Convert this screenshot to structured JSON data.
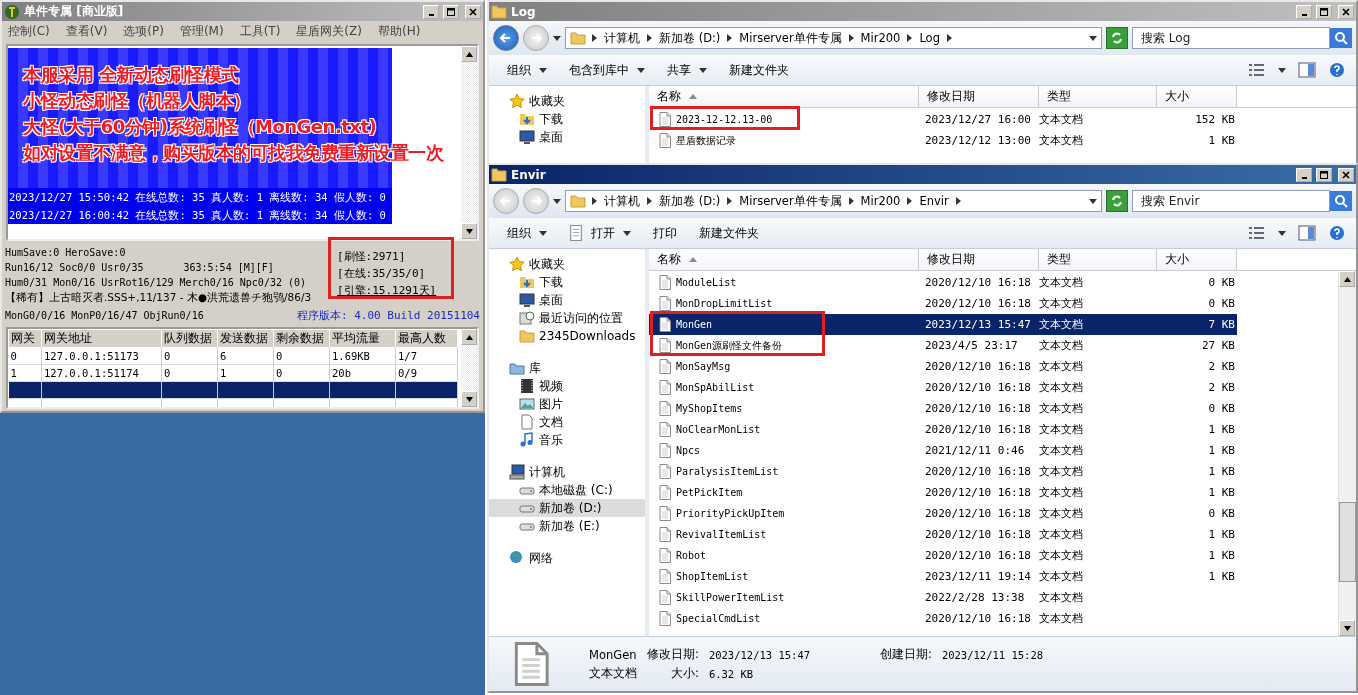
{
  "server_window": {
    "title": "单件专属 [商业版]",
    "active": false,
    "menu": [
      "控制(C)",
      "查看(V)",
      "选项(P)",
      "管理(M)",
      "工具(T)",
      "星盾网关(Z)",
      "帮助(H)"
    ],
    "overlay_lines": [
      "本服采用 全新动态刷怪模式",
      "小怪动态刷怪（机器人脚本）",
      "大怪(大于60分钟)系统刷怪（MonGen.txt)",
      "如对设置不满意，购买版本的可找我免费重新设置一次"
    ],
    "log_lines": [
      "2023/12/27 15:50:42 在线总数: 35 真人数: 1 离线数: 34 假人数: 0",
      "2023/12/27 16:00:42 在线总数: 35 真人数: 1 离线数: 34 假人数: 0"
    ],
    "status_lines": [
      "HumSave:0 HeroSave:0",
      "Run16/12 Soc0/0 Usr0/35",
      "Hum0/31 Mon0/16 UsrRot16/129 Merch0/16 Npc0/32 (0)",
      "【稀有】上古暗灭者.SSS+,11/137 - 木●洪荒遗兽チ狍鸮/86/3",
      "MonG0/0/16 MonP0/16/47 ObjRun0/16"
    ],
    "clock": "363:5:54 [M][F]",
    "counters": [
      "[刷怪:2971]",
      "[在线:35/35/0]",
      "[引擎:15.1291天]"
    ],
    "version": "程序版本: 4.00 Build 20151104",
    "gateway_table": {
      "columns": [
        "网关",
        "网关地址",
        "队列数据",
        "发送数据",
        "剩余数据",
        "平均流量",
        "最高人数"
      ],
      "rows": [
        {
          "cells": [
            "0",
            "127.0.0.1:51173",
            "0",
            "6",
            "0",
            "1.69KB",
            "1/7"
          ],
          "selected": false
        },
        {
          "cells": [
            "1",
            "127.0.0.1:51174",
            "0",
            "1",
            "0",
            "20b",
            "0/9"
          ],
          "selected": false
        },
        {
          "selected": true
        }
      ]
    }
  },
  "log_window": {
    "title": "Log",
    "active": false,
    "back_enabled": true,
    "breadcrumb": [
      "计算机",
      "新加卷 (D:)",
      "Mirserver单件专属",
      "Mir200",
      "Log"
    ],
    "search": {
      "placeholder": "搜索 Log"
    },
    "toolbar": [
      {
        "label": "组织",
        "dropdown": true
      },
      {
        "label": "包含到库中",
        "dropdown": true
      },
      {
        "label": "共享",
        "dropdown": true
      },
      {
        "label": "新建文件夹",
        "dropdown": false
      }
    ],
    "nav": [
      {
        "label": "收藏夹",
        "kind": "favorites",
        "selected": false,
        "children": [
          {
            "label": "下载",
            "kind": "downloads",
            "selected": false
          },
          {
            "label": "桌面",
            "kind": "desktop",
            "selected": false
          }
        ]
      }
    ],
    "columns": [
      "名称",
      "修改日期",
      "类型",
      "大小"
    ],
    "files": [
      {
        "name": "2023-12-12.13-00",
        "modified": "2023/12/27 16:00",
        "type": "文本文档",
        "size": "152 KB",
        "selected": false
      },
      {
        "name": "星盾数据记录",
        "modified": "2023/12/12 13:00",
        "type": "文本文档",
        "size": "1 KB",
        "selected": false
      }
    ]
  },
  "envir_window": {
    "title": "Envir",
    "active": true,
    "back_enabled": false,
    "breadcrumb": [
      "计算机",
      "新加卷 (D:)",
      "Mirserver单件专属",
      "Mir200",
      "Envir"
    ],
    "search": {
      "placeholder": "搜索 Envir"
    },
    "toolbar": [
      {
        "label": "组织",
        "dropdown": true
      },
      {
        "label": "打开",
        "dropdown": true
      },
      {
        "label": "打印",
        "dropdown": false
      },
      {
        "label": "新建文件夹",
        "dropdown": false
      }
    ],
    "nav": [
      {
        "label": "收藏夹",
        "kind": "favorites",
        "selected": false,
        "children": [
          {
            "label": "下载",
            "kind": "downloads",
            "selected": false
          },
          {
            "label": "桌面",
            "kind": "desktop",
            "selected": false
          },
          {
            "label": "最近访问的位置",
            "kind": "recent",
            "selected": false
          },
          {
            "label": "2345Downloads",
            "kind": "folder",
            "selected": false
          }
        ]
      },
      {
        "label": "库",
        "kind": "library",
        "selected": false,
        "children": [
          {
            "label": "视频",
            "kind": "video",
            "selected": false
          },
          {
            "label": "图片",
            "kind": "pictures",
            "selected": false
          },
          {
            "label": "文档",
            "kind": "documents",
            "selected": false
          },
          {
            "label": "音乐",
            "kind": "music",
            "selected": false
          }
        ]
      },
      {
        "label": "计算机",
        "kind": "computer",
        "selected": false,
        "children": [
          {
            "label": "本地磁盘 (C:)",
            "kind": "drive",
            "selected": false
          },
          {
            "label": "新加卷 (D:)",
            "kind": "drive",
            "selected": true
          },
          {
            "label": "新加卷 (E:)",
            "kind": "drive",
            "selected": false
          }
        ]
      },
      {
        "label": "网络",
        "kind": "network",
        "selected": false
      }
    ],
    "columns": [
      "名称",
      "修改日期",
      "类型",
      "大小"
    ],
    "files": [
      {
        "name": "ModuleList",
        "modified": "2020/12/10 16:18",
        "type": "文本文档",
        "size": "0 KB",
        "selected": false
      },
      {
        "name": "MonDropLimitList",
        "modified": "2020/12/10 16:18",
        "type": "文本文档",
        "size": "0 KB",
        "selected": false
      },
      {
        "name": "MonGen",
        "modified": "2023/12/13 15:47",
        "type": "文本文档",
        "size": "7 KB",
        "selected": true
      },
      {
        "name": "MonGen源刷怪文件备份",
        "modified": "2023/4/5 23:17",
        "type": "文本文档",
        "size": "27 KB",
        "selected": false
      },
      {
        "name": "MonSayMsg",
        "modified": "2020/12/10 16:18",
        "type": "文本文档",
        "size": "2 KB",
        "selected": false
      },
      {
        "name": "MonSpAbilList",
        "modified": "2020/12/10 16:18",
        "type": "文本文档",
        "size": "2 KB",
        "selected": false
      },
      {
        "name": "MyShopItems",
        "modified": "2020/12/10 16:18",
        "type": "文本文档",
        "size": "0 KB",
        "selected": false
      },
      {
        "name": "NoClearMonList",
        "modified": "2020/12/10 16:18",
        "type": "文本文档",
        "size": "1 KB",
        "selected": false
      },
      {
        "name": "Npcs",
        "modified": "2021/12/11 0:46",
        "type": "文本文档",
        "size": "1 KB",
        "selected": false
      },
      {
        "name": "ParalysisItemList",
        "modified": "2020/12/10 16:18",
        "type": "文本文档",
        "size": "1 KB",
        "selected": false
      },
      {
        "name": "PetPickItem",
        "modified": "2020/12/10 16:18",
        "type": "文本文档",
        "size": "1 KB",
        "selected": false
      },
      {
        "name": "PriorityPickUpItem",
        "modified": "2020/12/10 16:18",
        "type": "文本文档",
        "size": "0 KB",
        "selected": false
      },
      {
        "name": "RevivalItemList",
        "modified": "2020/12/10 16:18",
        "type": "文本文档",
        "size": "1 KB",
        "selected": false
      },
      {
        "name": "Robot",
        "modified": "2020/12/10 16:18",
        "type": "文本文档",
        "size": "1 KB",
        "selected": false
      },
      {
        "name": "ShopItemList",
        "modified": "2023/12/11 19:14",
        "type": "文本文档",
        "size": "1 KB",
        "selected": false
      },
      {
        "name": "SkillPowerItemList",
        "modified": "2022/2/28 13:38",
        "type": "文本文档",
        "selected": false
      },
      {
        "name": "SpecialCmdList",
        "modified": "2020/12/10 16:18",
        "type": "文本文档",
        "selected": false
      }
    ],
    "details": {
      "name": "MonGen",
      "type": "文本文档",
      "modified_label": "修改日期:",
      "modified": "2023/12/13 15:47",
      "created_label": "创建日期:",
      "created": "2023/12/11 15:28",
      "size_label": "大小:",
      "size": "6.32 KB"
    }
  }
}
